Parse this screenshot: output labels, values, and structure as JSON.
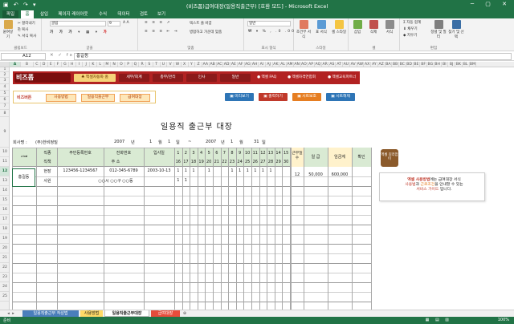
{
  "window": {
    "title": "(비즈폼)급여대장(일용직출근부) [호환 모드] - Microsoft Excel",
    "quick_access": "▣ ↶ ↷ ▾",
    "window_controls": "─ ▢ ✕"
  },
  "ribbon_tabs": [
    "파일",
    "홈",
    "삽입",
    "페이지 레이아웃",
    "수식",
    "데이터",
    "검토",
    "보기"
  ],
  "ribbon": {
    "paste": "붙여넣기",
    "cut": "잘라내기",
    "copy": "복사",
    "format_painter": "서식 복사",
    "clipboard_label": "클립보드",
    "font_name": "굴림",
    "font_size": "9",
    "font_label": "글꼴",
    "wrap_text": "텍스트 줄 바꿈",
    "merge_center": "병합하고 가운데 맞춤",
    "align_label": "맞춤",
    "number_format": "일반",
    "number_label": "표시 형식",
    "cond_format": "조건부 서식",
    "table_format": "표 서식",
    "cell_style": "셀 스타일",
    "style_label": "스타일",
    "insert": "삽입",
    "delete": "삭제",
    "format": "서식",
    "cells_label": "셀",
    "autosum": "자동 합계",
    "fill": "채우기",
    "clear": "지우기",
    "sort": "정렬 및 필터",
    "find": "찾기 및 선택",
    "edit_label": "편집"
  },
  "formula_bar": {
    "name_box": "A12",
    "fx": "✕ ✓ fx",
    "value": "홍길동"
  },
  "columns": [
    "A",
    "B",
    "C",
    "D",
    "E",
    "F",
    "G",
    "H",
    "I",
    "J",
    "K",
    "L",
    "M",
    "N",
    "O",
    "P",
    "Q",
    "R",
    "S",
    "T",
    "U",
    "V",
    "W",
    "X",
    "Y",
    "Z",
    "AA",
    "AB",
    "AC",
    "AD",
    "AE",
    "AF",
    "AG",
    "AH",
    "AI",
    "AJ",
    "AK",
    "AL",
    "AM",
    "AN",
    "AO",
    "AP",
    "AQ",
    "AR",
    "AS",
    "AT",
    "AU",
    "AV",
    "AW",
    "AX",
    "AY",
    "AZ",
    "BA",
    "BB",
    "BC",
    "BD",
    "BE",
    "BF",
    "BG",
    "BH",
    "BI",
    "BJ",
    "BK",
    "BL",
    "BM"
  ],
  "rows": [
    "1",
    "2",
    "3",
    "4",
    "5",
    "6",
    "7",
    "8",
    "9",
    "10",
    "11",
    "12",
    "13",
    "14",
    "15",
    "16",
    "17",
    "18",
    "19",
    "20",
    "21",
    "22",
    "23",
    "24",
    "25"
  ],
  "brand": {
    "logo": "비즈폼",
    "nav": [
      "♣ 엑셀자동화 홈",
      "세무/회계",
      "총무/관리",
      "인사",
      "일반"
    ],
    "links": [
      "● 엑셀 FAQ",
      "● 엑셀자격연합회",
      "● 엑셀교육파트너"
    ]
  },
  "tools": {
    "label": "비즈버튼",
    "buttons": [
      "사용방법",
      "일용직출근부",
      "급여대장"
    ],
    "actions": [
      "미리보기",
      "출력하기",
      "시트보호",
      "시트해제"
    ],
    "action_colors": [
      "#2e75b6",
      "#c0392b",
      "#e67e22",
      "#2e75b6"
    ]
  },
  "doc": {
    "title": "일용직 출근부 대장",
    "company_label": "회사명 :",
    "company": "(주)한비정밀",
    "period": [
      "2007",
      "년",
      "1",
      "월",
      "1",
      "일",
      "~",
      "2007",
      "년",
      "1",
      "월",
      "31",
      "일"
    ]
  },
  "table": {
    "header_row1": {
      "name": "성명",
      "title": "직종",
      "ssn": "주민등록번호",
      "phone": "전화번호",
      "hire": "입사일",
      "days": [
        "1",
        "2",
        "3",
        "4",
        "5",
        "6",
        "7",
        "8",
        "9",
        "10",
        "11",
        "12",
        "13",
        "14",
        "15"
      ],
      "workdays": "근무일수",
      "wage": "일 급",
      "pay": "임금계",
      "confirm": "확인"
    },
    "header_row2": {
      "title": "직책",
      "address": "주 소",
      "days": [
        "16",
        "17",
        "18",
        "19",
        "20",
        "21",
        "22",
        "23",
        "24",
        "25",
        "26",
        "27",
        "28",
        "29",
        "30",
        "31"
      ]
    },
    "rows": [
      {
        "name": "홍길동",
        "title": "현장",
        "position": "사원",
        "ssn": "123456-1234567",
        "phone": "012-345-6789",
        "hire": "2003-10-13",
        "address": "○○시 ○○구 ○○동",
        "marks1": [
          "1",
          "1",
          "1",
          "",
          "1",
          "",
          "",
          "1",
          "1",
          "1",
          "1",
          "1",
          "1",
          "",
          ""
        ],
        "marks2": [
          "1",
          "1",
          "",
          "",
          "",
          "",
          "",
          "",
          "",
          "",
          "",
          "",
          "",
          "",
          "",
          ""
        ],
        "workdays": "12",
        "wage": "50,000",
        "pay": "600,000"
      }
    ]
  },
  "tip": {
    "icon_text": "엑셀 길라잡이",
    "line1": "엑셀 사용방법",
    "line1b": "에는 급여대장 서식",
    "line2": "사용법",
    "line2b": "과 ",
    "line2c": "근로조건",
    "line2d": "을 안내할 수 있는",
    "line3": "서비스 가이드",
    "line3b": " 입니다."
  },
  "sheets": [
    "일용직출근부 작성법",
    "사용방법",
    "일용직출근부대장",
    "급여대장"
  ],
  "status": {
    "left": "준비",
    "zoom": "100%"
  }
}
